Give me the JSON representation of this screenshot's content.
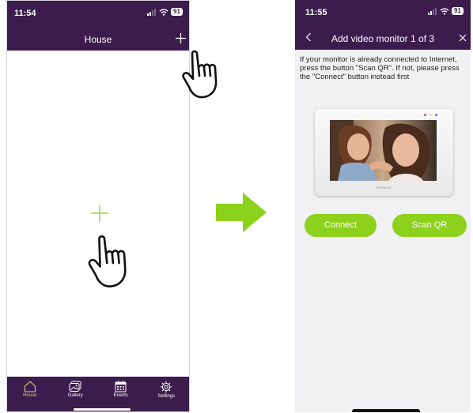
{
  "colors": {
    "brand_purple": "#3c1c4d",
    "accent_green": "#8cd11b",
    "active_tab": "#c7d77a"
  },
  "left_screen": {
    "status": {
      "time": "11:54",
      "battery": "91"
    },
    "title": "House",
    "header_icon": "plus-icon",
    "center_icon": "plus-icon",
    "tabs": [
      {
        "label": "House",
        "icon": "home-icon",
        "active": true
      },
      {
        "label": "Gallery",
        "icon": "gallery-icon",
        "active": false
      },
      {
        "label": "Events",
        "icon": "calendar-icon",
        "active": false
      },
      {
        "label": "Settings",
        "icon": "gear-icon",
        "active": false
      }
    ],
    "pointers": [
      "hand-pointer-icon",
      "hand-pointer-icon"
    ]
  },
  "flow_arrow": {
    "icon": "arrow-right-icon",
    "color": "#8cd11b"
  },
  "right_screen": {
    "status": {
      "time": "11:55",
      "battery": "91"
    },
    "title": "Add video monitor 1 of 3",
    "instructions": "If your monitor is already connected to Internet, press the button \"Scan QR\". If not, please press the \"Connect\" button instead first",
    "monitor_brand": "FERMAX",
    "buttons": {
      "connect": "Connect",
      "scan_qr": "Scan QR"
    }
  }
}
